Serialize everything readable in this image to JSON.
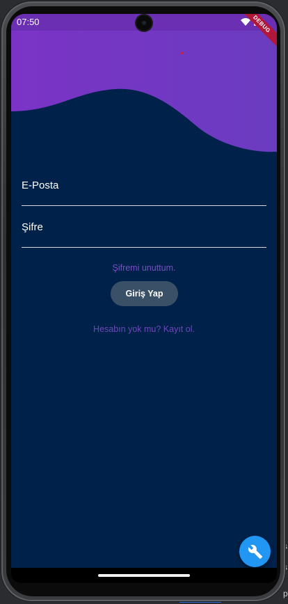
{
  "status_bar": {
    "time": "07:50"
  },
  "debug_banner": "DEBUG",
  "form": {
    "email_label": "E-Posta",
    "password_label": "Şifre",
    "forgot_password": "Şifremi unuttum.",
    "login_button": "Giriş Yap",
    "signup_prompt": "Hesabın yok mu? Kayıt ol."
  },
  "fab": {
    "icon": "wrench-icon"
  },
  "background_text": [
    "s",
    "s",
    "pe"
  ],
  "colors": {
    "background": "#00214a",
    "header_purple": "#7a35c8",
    "link_purple": "#7a4fc4",
    "button": "#3a5067",
    "fab": "#2196f3"
  }
}
